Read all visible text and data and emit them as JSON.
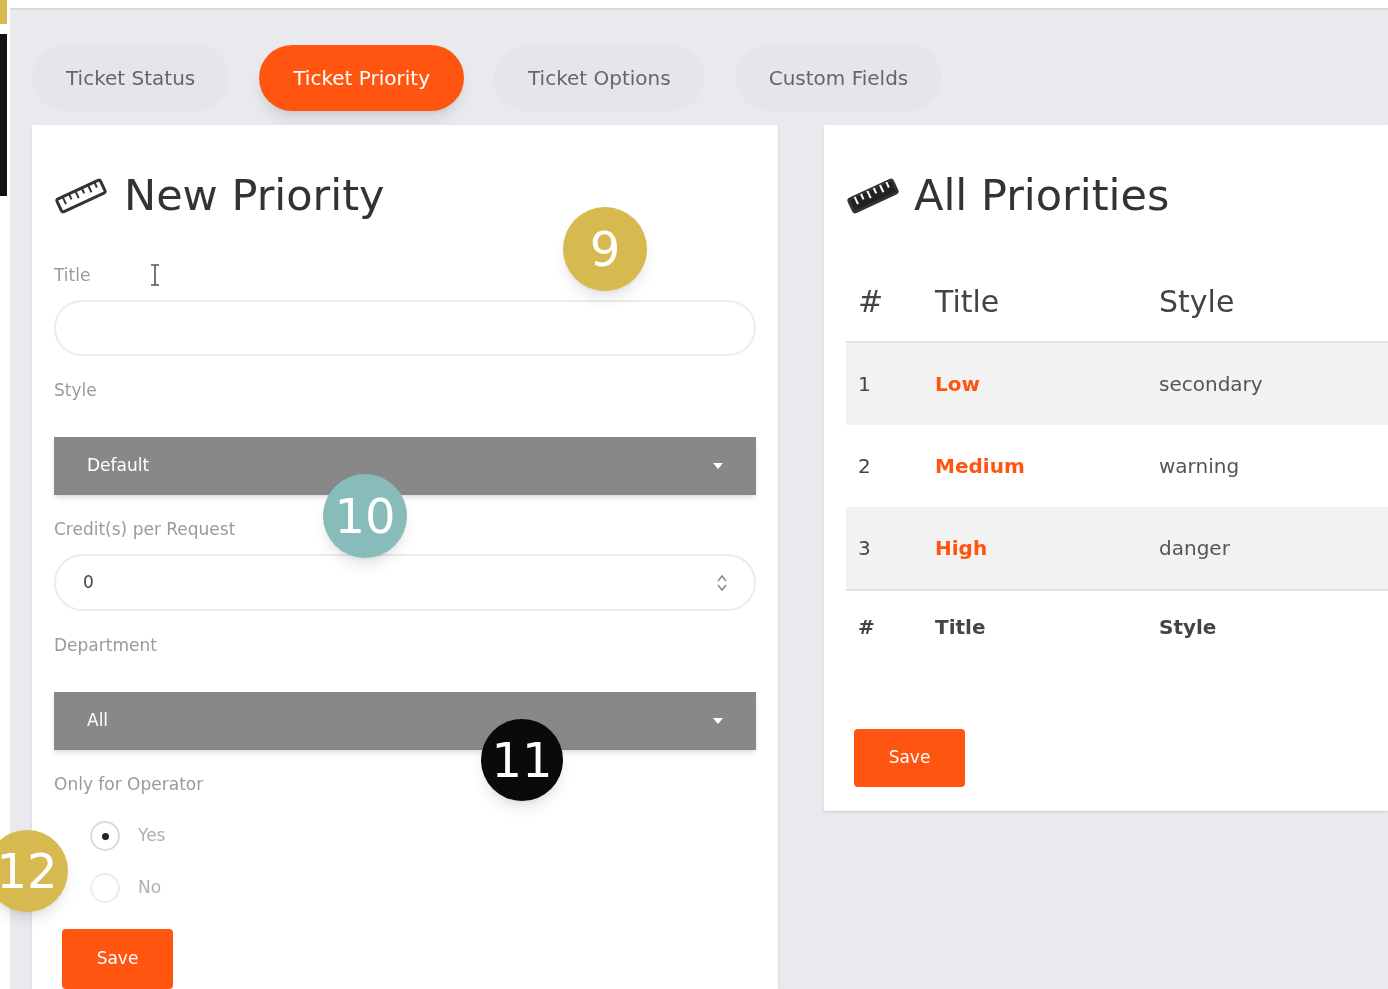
{
  "tabs": [
    {
      "label": "Ticket Status",
      "selected": false
    },
    {
      "label": "Ticket Priority",
      "selected": true
    },
    {
      "label": "Ticket Options",
      "selected": false
    },
    {
      "label": "Custom Fields",
      "selected": false
    }
  ],
  "new_priority": {
    "heading": "New Priority",
    "fields": [
      {
        "kind": "text",
        "label": "Title"
      },
      {
        "kind": "select",
        "label": "Style",
        "value": "Default"
      },
      {
        "kind": "number",
        "label": "Credit(s) per Request",
        "value": "0"
      },
      {
        "kind": "select",
        "label": "Department",
        "value": "All"
      },
      {
        "kind": "radio",
        "label": "Only for Operator",
        "options": [
          {
            "label": "Yes",
            "selected": true
          },
          {
            "label": "No",
            "selected": false
          }
        ]
      }
    ],
    "save_button": "Save"
  },
  "all_priorities": {
    "heading": "All Priorities",
    "columns": [
      "#",
      "Title",
      "Style"
    ],
    "rows": [
      [
        "1",
        "Low",
        "secondary"
      ],
      [
        "2",
        "Medium",
        "warning"
      ],
      [
        "3",
        "High",
        "danger"
      ]
    ],
    "footer": [
      "#",
      "Title",
      "Style"
    ],
    "save_button": "Save"
  },
  "callouts": [
    {
      "label": "9",
      "color": "#d6b94f"
    },
    {
      "label": "10",
      "color": "#88bcbb"
    },
    {
      "label": "11",
      "color": "#0a0a0a"
    },
    {
      "label": "12",
      "color": "#d6b94f"
    }
  ]
}
